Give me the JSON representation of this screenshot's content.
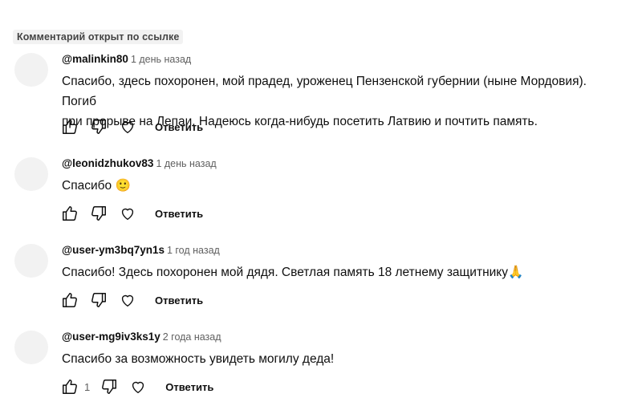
{
  "badge": "Комментарий открыт по ссылке",
  "comments": [
    {
      "author": "@malinkin80",
      "time": "1 день назад",
      "text": "Спасибо, здесь похоронен, мой прадед, уроженец Пензенской губернии (ныне Мордовия). Погиб\nпри прорыве на Лепаи. Надеюсь когда-нибудь посетить Латвию и почтить память.",
      "likes": "",
      "reply_label": "Ответить"
    },
    {
      "author": "@leonidzhukov83",
      "time": "1 день назад",
      "text": "Спасибо",
      "emoji": "🙂",
      "likes": "",
      "reply_label": "Ответить"
    },
    {
      "author": "@user-ym3bq7yn1s",
      "time": "1 год назад",
      "text": "Спасибо! Здесь похоронен мой дядя. Светлая память 18 летнему защитнику",
      "emoji": "🙏",
      "likes": "",
      "reply_label": "Ответить"
    },
    {
      "author": "@user-mg9iv3ks1y",
      "time": "2 года назад",
      "text": "Спасибо за возможность увидеть могилу деда!",
      "likes": "1",
      "reply_label": "Ответить"
    }
  ],
  "icons": {
    "like": "thumb-up-icon",
    "dislike": "thumb-down-icon",
    "heart": "heart-icon"
  }
}
